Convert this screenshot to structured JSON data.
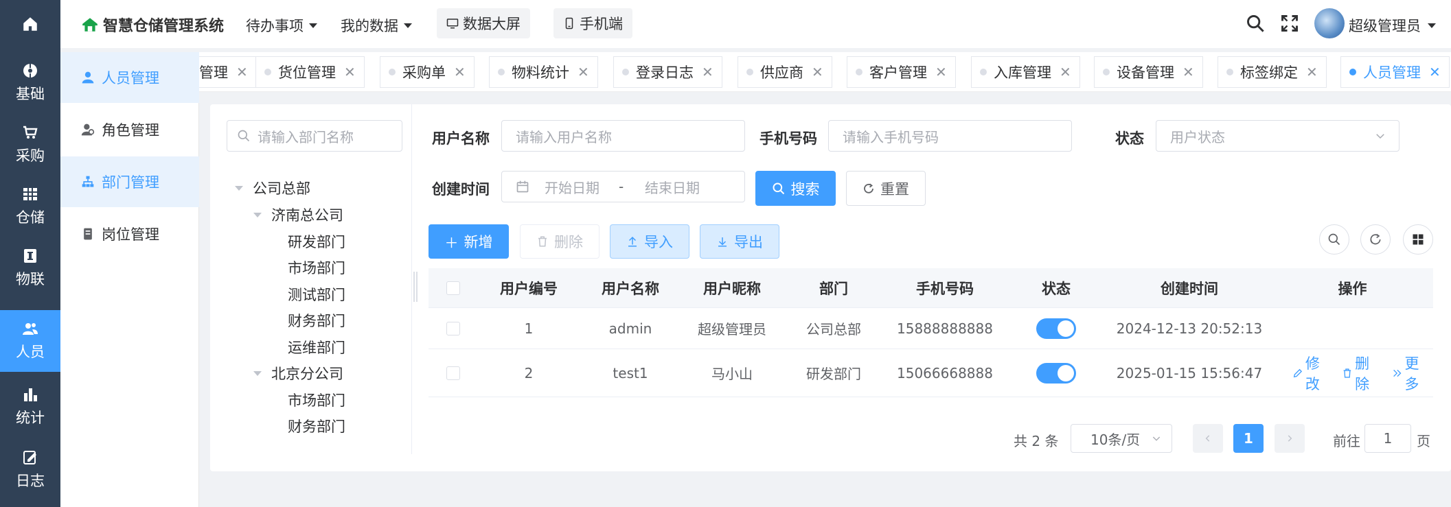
{
  "rail": {
    "items": [
      {
        "label": "",
        "icon": "home-icon"
      },
      {
        "label": "基础",
        "icon": "base-icon"
      },
      {
        "label": "采购",
        "icon": "cart-icon"
      },
      {
        "label": "仓储",
        "icon": "grid-icon"
      },
      {
        "label": "物联",
        "icon": "iot-icon"
      },
      {
        "label": "人员",
        "icon": "users-icon"
      },
      {
        "label": "统计",
        "icon": "chart-icon"
      },
      {
        "label": "日志",
        "icon": "log-icon"
      }
    ]
  },
  "submenu": {
    "items": [
      {
        "label": "人员管理"
      },
      {
        "label": "角色管理"
      },
      {
        "label": "部门管理"
      },
      {
        "label": "岗位管理"
      }
    ]
  },
  "header": {
    "title": "智慧仓储管理系统",
    "todo": "待办事项",
    "mydata": "我的数据",
    "bigscreen": "数据大屏",
    "mobile": "手机端",
    "user": "超级管理员"
  },
  "tags": [
    {
      "label": "管理"
    },
    {
      "label": "货位管理"
    },
    {
      "label": "采购单"
    },
    {
      "label": "物料统计"
    },
    {
      "label": "登录日志"
    },
    {
      "label": "供应商"
    },
    {
      "label": "客户管理"
    },
    {
      "label": "入库管理"
    },
    {
      "label": "设备管理"
    },
    {
      "label": "标签绑定"
    },
    {
      "label": "人员管理"
    }
  ],
  "tree": {
    "placeholder": "请输入部门名称",
    "nodes": [
      {
        "label": "公司总部"
      },
      {
        "label": "济南总公司"
      },
      {
        "label": "研发部门"
      },
      {
        "label": "市场部门"
      },
      {
        "label": "测试部门"
      },
      {
        "label": "财务部门"
      },
      {
        "label": "运维部门"
      },
      {
        "label": "北京分公司"
      },
      {
        "label": "市场部门"
      },
      {
        "label": "财务部门"
      }
    ]
  },
  "search": {
    "username_label": "用户名称",
    "username_ph": "请输入用户名称",
    "phone_label": "手机号码",
    "phone_ph": "请输入手机号码",
    "status_label": "状态",
    "status_ph": "用户状态",
    "created_label": "创建时间",
    "start_ph": "开始日期",
    "range_sep": "-",
    "end_ph": "结束日期",
    "search_btn": "搜索",
    "reset_btn": "重置"
  },
  "toolbar": {
    "add": "新增",
    "delete": "删除",
    "import": "导入",
    "export": "导出"
  },
  "table": {
    "headers": [
      "用户编号",
      "用户名称",
      "用户昵称",
      "部门",
      "手机号码",
      "状态",
      "创建时间",
      "操作"
    ],
    "rows": [
      {
        "id": "1",
        "name": "admin",
        "nick": "超级管理员",
        "dept": "公司总部",
        "phone": "15888888888",
        "status": true,
        "created": "2024-12-13 20:52:13"
      },
      {
        "id": "2",
        "name": "test1",
        "nick": "马小山",
        "dept": "研发部门",
        "phone": "15066668888",
        "status": true,
        "created": "2025-01-15 15:56:47"
      }
    ],
    "ops": {
      "edit": "修改",
      "delete": "删除",
      "more": "更多"
    }
  },
  "pager": {
    "total": "共 2 条",
    "size": "10条/页",
    "current": "1",
    "goto": "前往",
    "goto_value": "1",
    "page_unit": "页"
  },
  "colors": {
    "accent": "#409eff",
    "rail": "#304156"
  }
}
